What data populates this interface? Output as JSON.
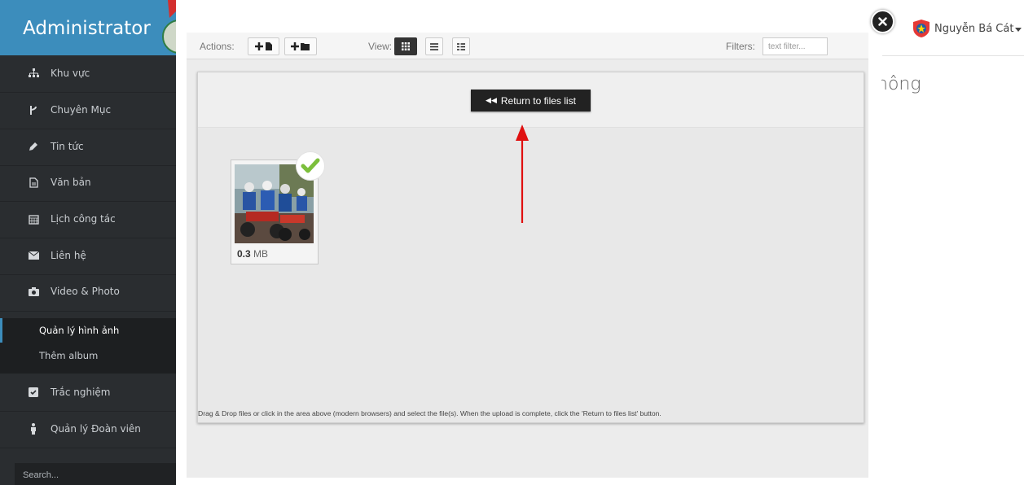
{
  "app_title": "Administrator",
  "user": {
    "name": "Nguyễn Bá Cát"
  },
  "background": {
    "heading_fragment": "hông"
  },
  "sidebar": {
    "items": [
      {
        "label": "Khu vực",
        "icon": "sitemap-icon"
      },
      {
        "label": "Chuyên Mục",
        "icon": "code-fork-icon"
      },
      {
        "label": "Tin tức",
        "icon": "pencil-icon"
      },
      {
        "label": "Văn bản",
        "icon": "file-text-icon"
      },
      {
        "label": "Lịch công tác",
        "icon": "calendar-icon"
      },
      {
        "label": "Liên hệ",
        "icon": "envelope-icon"
      },
      {
        "label": "Video & Photo",
        "icon": "camera-icon"
      },
      {
        "label": "Trắc nghiệm",
        "icon": "check-square-icon"
      },
      {
        "label": "Quản lý Đoàn viên",
        "icon": "male-icon"
      }
    ],
    "sub_items": [
      {
        "label": "Quản lý hình ảnh",
        "active": true
      },
      {
        "label": "Thêm album",
        "active": false
      }
    ],
    "search_placeholder": "Search..."
  },
  "file_manager": {
    "actions_label": "Actions:",
    "view_label": "View:",
    "filters_label": "Filters:",
    "filter_placeholder": "text filter...",
    "return_button": "Return to files list",
    "file": {
      "size_value": "0.3",
      "size_unit": "MB"
    },
    "hint": "Drag & Drop files or click in the area above (modern browsers) and select the file(s). When the upload is complete, click the 'Return to files list' button."
  },
  "colors": {
    "sidebar_bg": "#2a2d30",
    "brand_bg": "#3c8dbc",
    "check_green": "#7cbf3c",
    "arrow_red": "#e01010"
  }
}
